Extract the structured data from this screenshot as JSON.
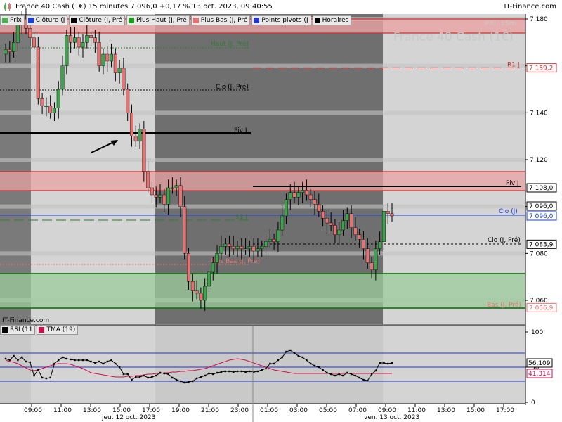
{
  "header": {
    "title": "France 40 Cash (1€) 15 minutes 7 096,0 +0,17 % 13 oct. 2023, 09:40:55",
    "brand": "IT-Finance.com"
  },
  "legend": [
    {
      "label": "Prix",
      "color": "#4caf50"
    },
    {
      "label": "Clôture (J",
      "color": "#1a3fd6"
    },
    {
      "label": "Clôture (J, Pré",
      "color": "#000000"
    },
    {
      "label": "Plus Haut (J, Pré",
      "color": "#1a9e1a"
    },
    {
      "label": "Plus Bas (J, Pré",
      "color": "#e57373"
    },
    {
      "label": "Points pivots (J",
      "color": "#2233cc"
    },
    {
      "label": "Horaires",
      "color": "#000000"
    }
  ],
  "watermark": {
    "big": "France 40 Cash (1€)",
    "small": "PXI, 15m"
  },
  "source_label": "IT-Finance.com",
  "levels": {
    "r1": {
      "label": "R1 J",
      "value_text": "7 159,2",
      "value": 7159.2,
      "color": "#d32f2f"
    },
    "haut": {
      "label": "Haut (J, Pré)",
      "value": 7175.0,
      "color": "#2e7d32"
    },
    "clo_pre_top": {
      "label": "Clo (J, Pré)",
      "value": 7150.0
    },
    "piv_prev": {
      "label": "Piv J",
      "value": 7131.0
    },
    "piv": {
      "label": "Piv J",
      "value_text": "7 108,0",
      "value": 7108.0
    },
    "clo_j": {
      "label": "Clo (J)",
      "value_text": "7 096,0",
      "value": 7096.0,
      "color": "#1a3fd6"
    },
    "clo_pre": {
      "label": "Clo (J, Pré)",
      "value_text": "7 083,9",
      "value": 7083.9
    },
    "s1": {
      "label": "S1 J",
      "value": 7094.0,
      "color": "#2e7d32"
    },
    "plus_bas": {
      "label": "Plus Bas (J, Pré)",
      "value": 7076.0
    },
    "bas": {
      "label": "Bas (J, Pré)",
      "value_text": "7 056,9",
      "value": 7056.9,
      "color": "#e57373"
    },
    "current": {
      "value_text": "7 096,0",
      "value": 7096.0
    }
  },
  "rsi_legend": [
    {
      "label": "RSI (11",
      "color": "#000000"
    },
    {
      "label": "TMA (19)",
      "color": "#d0104c"
    }
  ],
  "rsi_values": {
    "rsi_text": "56,109",
    "tma_text": "41,314"
  },
  "chart_data": [
    {
      "type": "candlestick",
      "title": "France 40 Cash (1€) 15 minutes",
      "ylim": [
        7054,
        7185
      ],
      "y_ticks": [
        7060,
        7080,
        7100,
        7120,
        7140,
        7160,
        7180
      ],
      "y_tick_labels": [
        "7 060",
        "7 080",
        "7 100",
        "7 120",
        "7 140",
        "7 160",
        "7 180"
      ],
      "x_tick_labels": [
        "09:00",
        "11:00",
        "13:00",
        "15:00",
        "17:00",
        "19:00",
        "21:00",
        "23:00",
        "01:00",
        "03:00",
        "05:00",
        "07:00",
        "09:00",
        "11:00",
        "13:00",
        "15:00",
        "17:00"
      ],
      "date_labels": [
        "jeu. 12 oct. 2023",
        "ven. 13 oct. 2023"
      ],
      "close_series": [
        7167,
        7166,
        7170,
        7178,
        7180,
        7176,
        7172,
        7168,
        7146,
        7143,
        7143,
        7140,
        7142,
        7150,
        7160,
        7173,
        7170,
        7172,
        7168,
        7170,
        7173,
        7172,
        7170,
        7160,
        7165,
        7162,
        7165,
        7157,
        7159,
        7150,
        7140,
        7130,
        7128,
        7133,
        7115,
        7108,
        7105,
        7104,
        7105,
        7101,
        7108,
        7108,
        7109,
        7100,
        7080,
        7068,
        7064,
        7063,
        7060,
        7066,
        7072,
        7076,
        7080,
        7083,
        7084,
        7083,
        7082,
        7083,
        7082,
        7082,
        7083,
        7081,
        7082,
        7083,
        7085,
        7086,
        7085,
        7090,
        7096,
        7103,
        7106,
        7104,
        7106,
        7107,
        7105,
        7103,
        7101,
        7098,
        7095,
        7093,
        7092,
        7088,
        7090,
        7094,
        7097,
        7091,
        7088,
        7086,
        7082,
        7076,
        7073,
        7082,
        7085,
        7098,
        7097,
        7096
      ],
      "levels": [
        7159.2,
        7175.0,
        7150.0,
        7131.0,
        7108.0,
        7096.0,
        7083.9,
        7094.0,
        7076.0,
        7056.9
      ]
    },
    {
      "type": "line",
      "title": "RSI (11) / TMA (19)",
      "ylim": [
        0,
        100
      ],
      "y_ticks": [
        0,
        50,
        100
      ],
      "bands": [
        30,
        50,
        70
      ],
      "series": [
        {
          "name": "RSI (11",
          "values": [
            62,
            60,
            66,
            60,
            64,
            58,
            57,
            38,
            46,
            35,
            34,
            35,
            55,
            60,
            64,
            62,
            61,
            60,
            60,
            60,
            60,
            58,
            56,
            58,
            55,
            58,
            60,
            55,
            50,
            40,
            40,
            32,
            36,
            36,
            38,
            35,
            36,
            38,
            42,
            41,
            40,
            35,
            32,
            30,
            28,
            29,
            30,
            34,
            36,
            38,
            41,
            40,
            42,
            43,
            44,
            44,
            43,
            44,
            44,
            43,
            44,
            43,
            44,
            46,
            48,
            55,
            55,
            60,
            64,
            72,
            74,
            70,
            66,
            64,
            60,
            55,
            52,
            50,
            46,
            42,
            40,
            38,
            40,
            38,
            42,
            40,
            38,
            35,
            32,
            31,
            40,
            45,
            56,
            56,
            55,
            56
          ]
        },
        {
          "name": "TMA (19)",
          "values": [
            60,
            58,
            57,
            55,
            52,
            49,
            46,
            45,
            46,
            48,
            50,
            52,
            54,
            55,
            55,
            55,
            54,
            52,
            50,
            48,
            45,
            42,
            41,
            40,
            39,
            38,
            37,
            36,
            36,
            36,
            37,
            37,
            38,
            38,
            39,
            40,
            40,
            41,
            41,
            42,
            42,
            43,
            43,
            44,
            44,
            45,
            45,
            46,
            47,
            48,
            50,
            52,
            54,
            56,
            58,
            60,
            61,
            62,
            61,
            60,
            58,
            56,
            54,
            52,
            50,
            48,
            46,
            45,
            44,
            43,
            42,
            41,
            41,
            41,
            41,
            41,
            41,
            41,
            41,
            41,
            41,
            41,
            41,
            41,
            41,
            41,
            41,
            41,
            41,
            41,
            41,
            41,
            41,
            41,
            41,
            41
          ]
        }
      ]
    }
  ]
}
